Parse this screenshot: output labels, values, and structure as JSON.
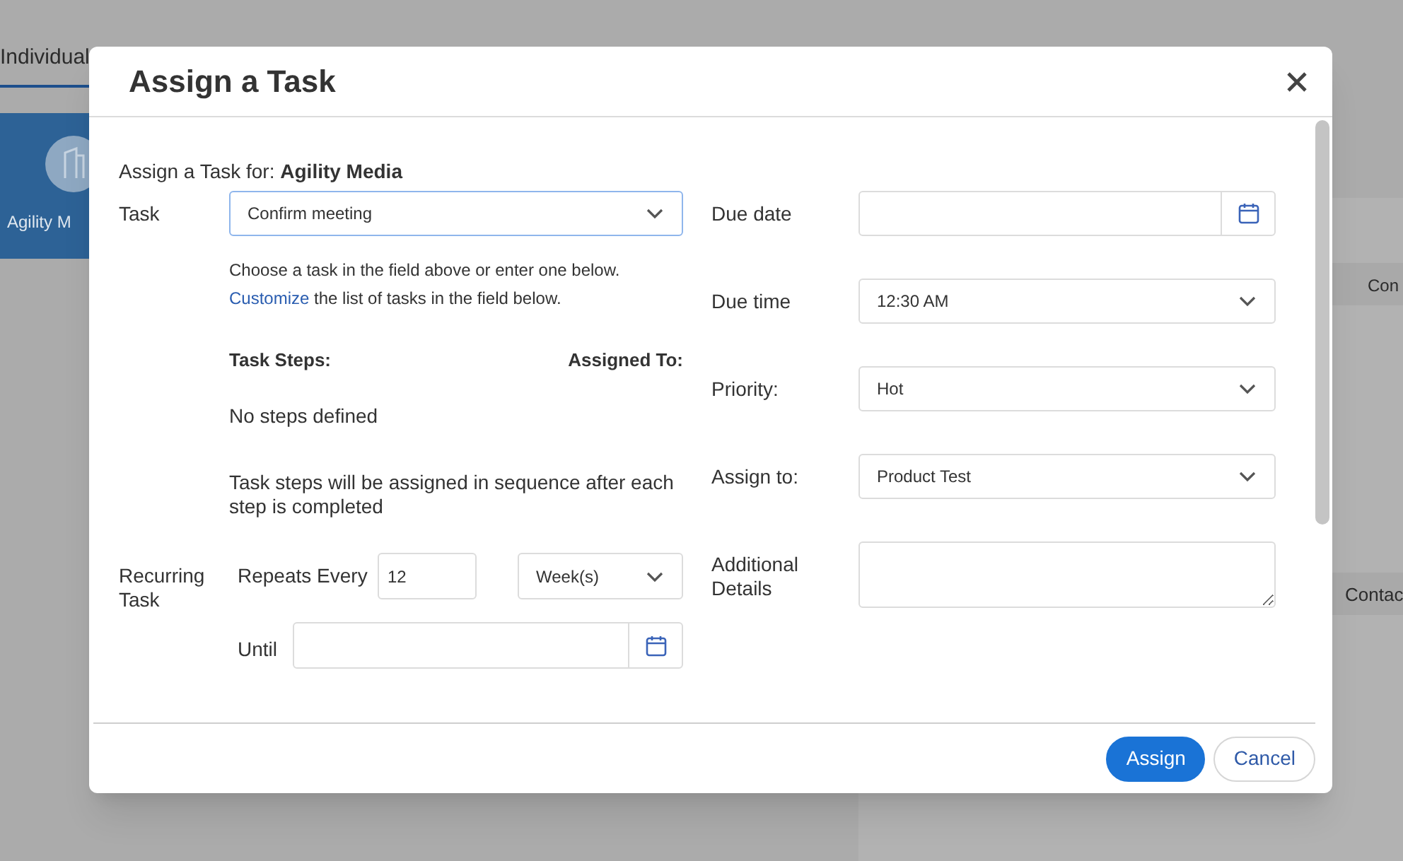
{
  "background": {
    "tab": {
      "label": "Individual",
      "selected": true
    },
    "card": {
      "label": "Agility M"
    },
    "column_headers": [
      "Con",
      "Contac"
    ]
  },
  "dialog": {
    "title": "Assign a Task",
    "subtitle": "Assign a Task for: **Agility Media**",
    "task": {
      "label": "Task",
      "value": "Confirm meeting"
    },
    "help": {
      "line": "Choose a task in the field above or enter one below.",
      "link": "Customize",
      "rest": " the list of tasks in the field below."
    },
    "steps": {
      "columns": [
        "Task Steps:",
        "Assigned To:"
      ],
      "empty": "No steps defined",
      "note": "Task steps will be assigned in sequence after each step is completed"
    },
    "recurring": {
      "label": "Recurring Task",
      "repeats_label": "Repeats Every",
      "repeats_value": "12",
      "unit": "Week(s)",
      "until_label": "Until"
    },
    "right_fields": [
      {
        "kind": "date",
        "label": "Due date"
      },
      {
        "kind": "select",
        "label": "Due time",
        "value": "12:30 AM"
      },
      {
        "kind": "select",
        "label": "Priority:",
        "value": "Hot"
      },
      {
        "kind": "select",
        "label": "Assign to:",
        "value": "Product Test"
      },
      {
        "kind": "textarea",
        "label": "Additional Details"
      }
    ],
    "buttons": [
      {
        "kind": "primary",
        "label": "Assign"
      },
      {
        "kind": "secondary",
        "label": "Cancel"
      }
    ]
  }
}
